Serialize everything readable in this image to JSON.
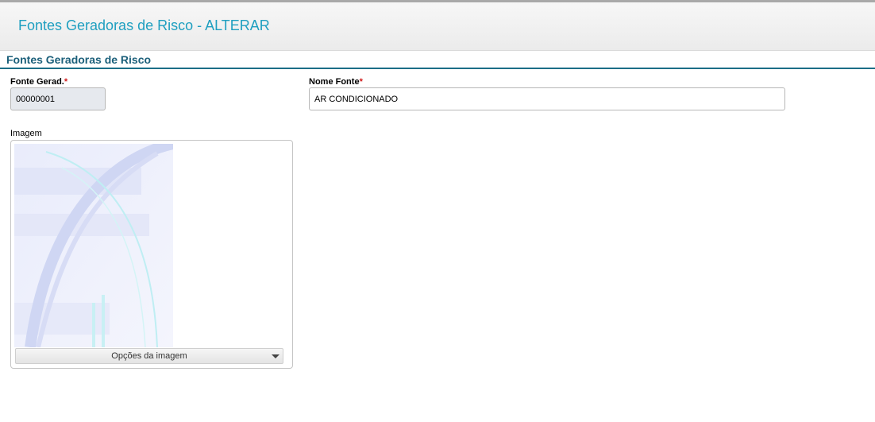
{
  "header": {
    "title": "Fontes Geradoras de Risco - ALTERAR"
  },
  "section": {
    "title": "Fontes Geradoras de Risco"
  },
  "fields": {
    "fonte_gerad": {
      "label": "Fonte Gerad.",
      "required_mark": "*",
      "value": "00000001"
    },
    "nome_fonte": {
      "label": "Nome Fonte",
      "required_mark": "*",
      "value": "AR CONDICIONADO"
    }
  },
  "image": {
    "label": "Imagem",
    "options_label": "Opções da imagem"
  },
  "colors": {
    "title": "#1f9fc0",
    "section": "#1b5f7a",
    "required": "#d01a1a"
  }
}
